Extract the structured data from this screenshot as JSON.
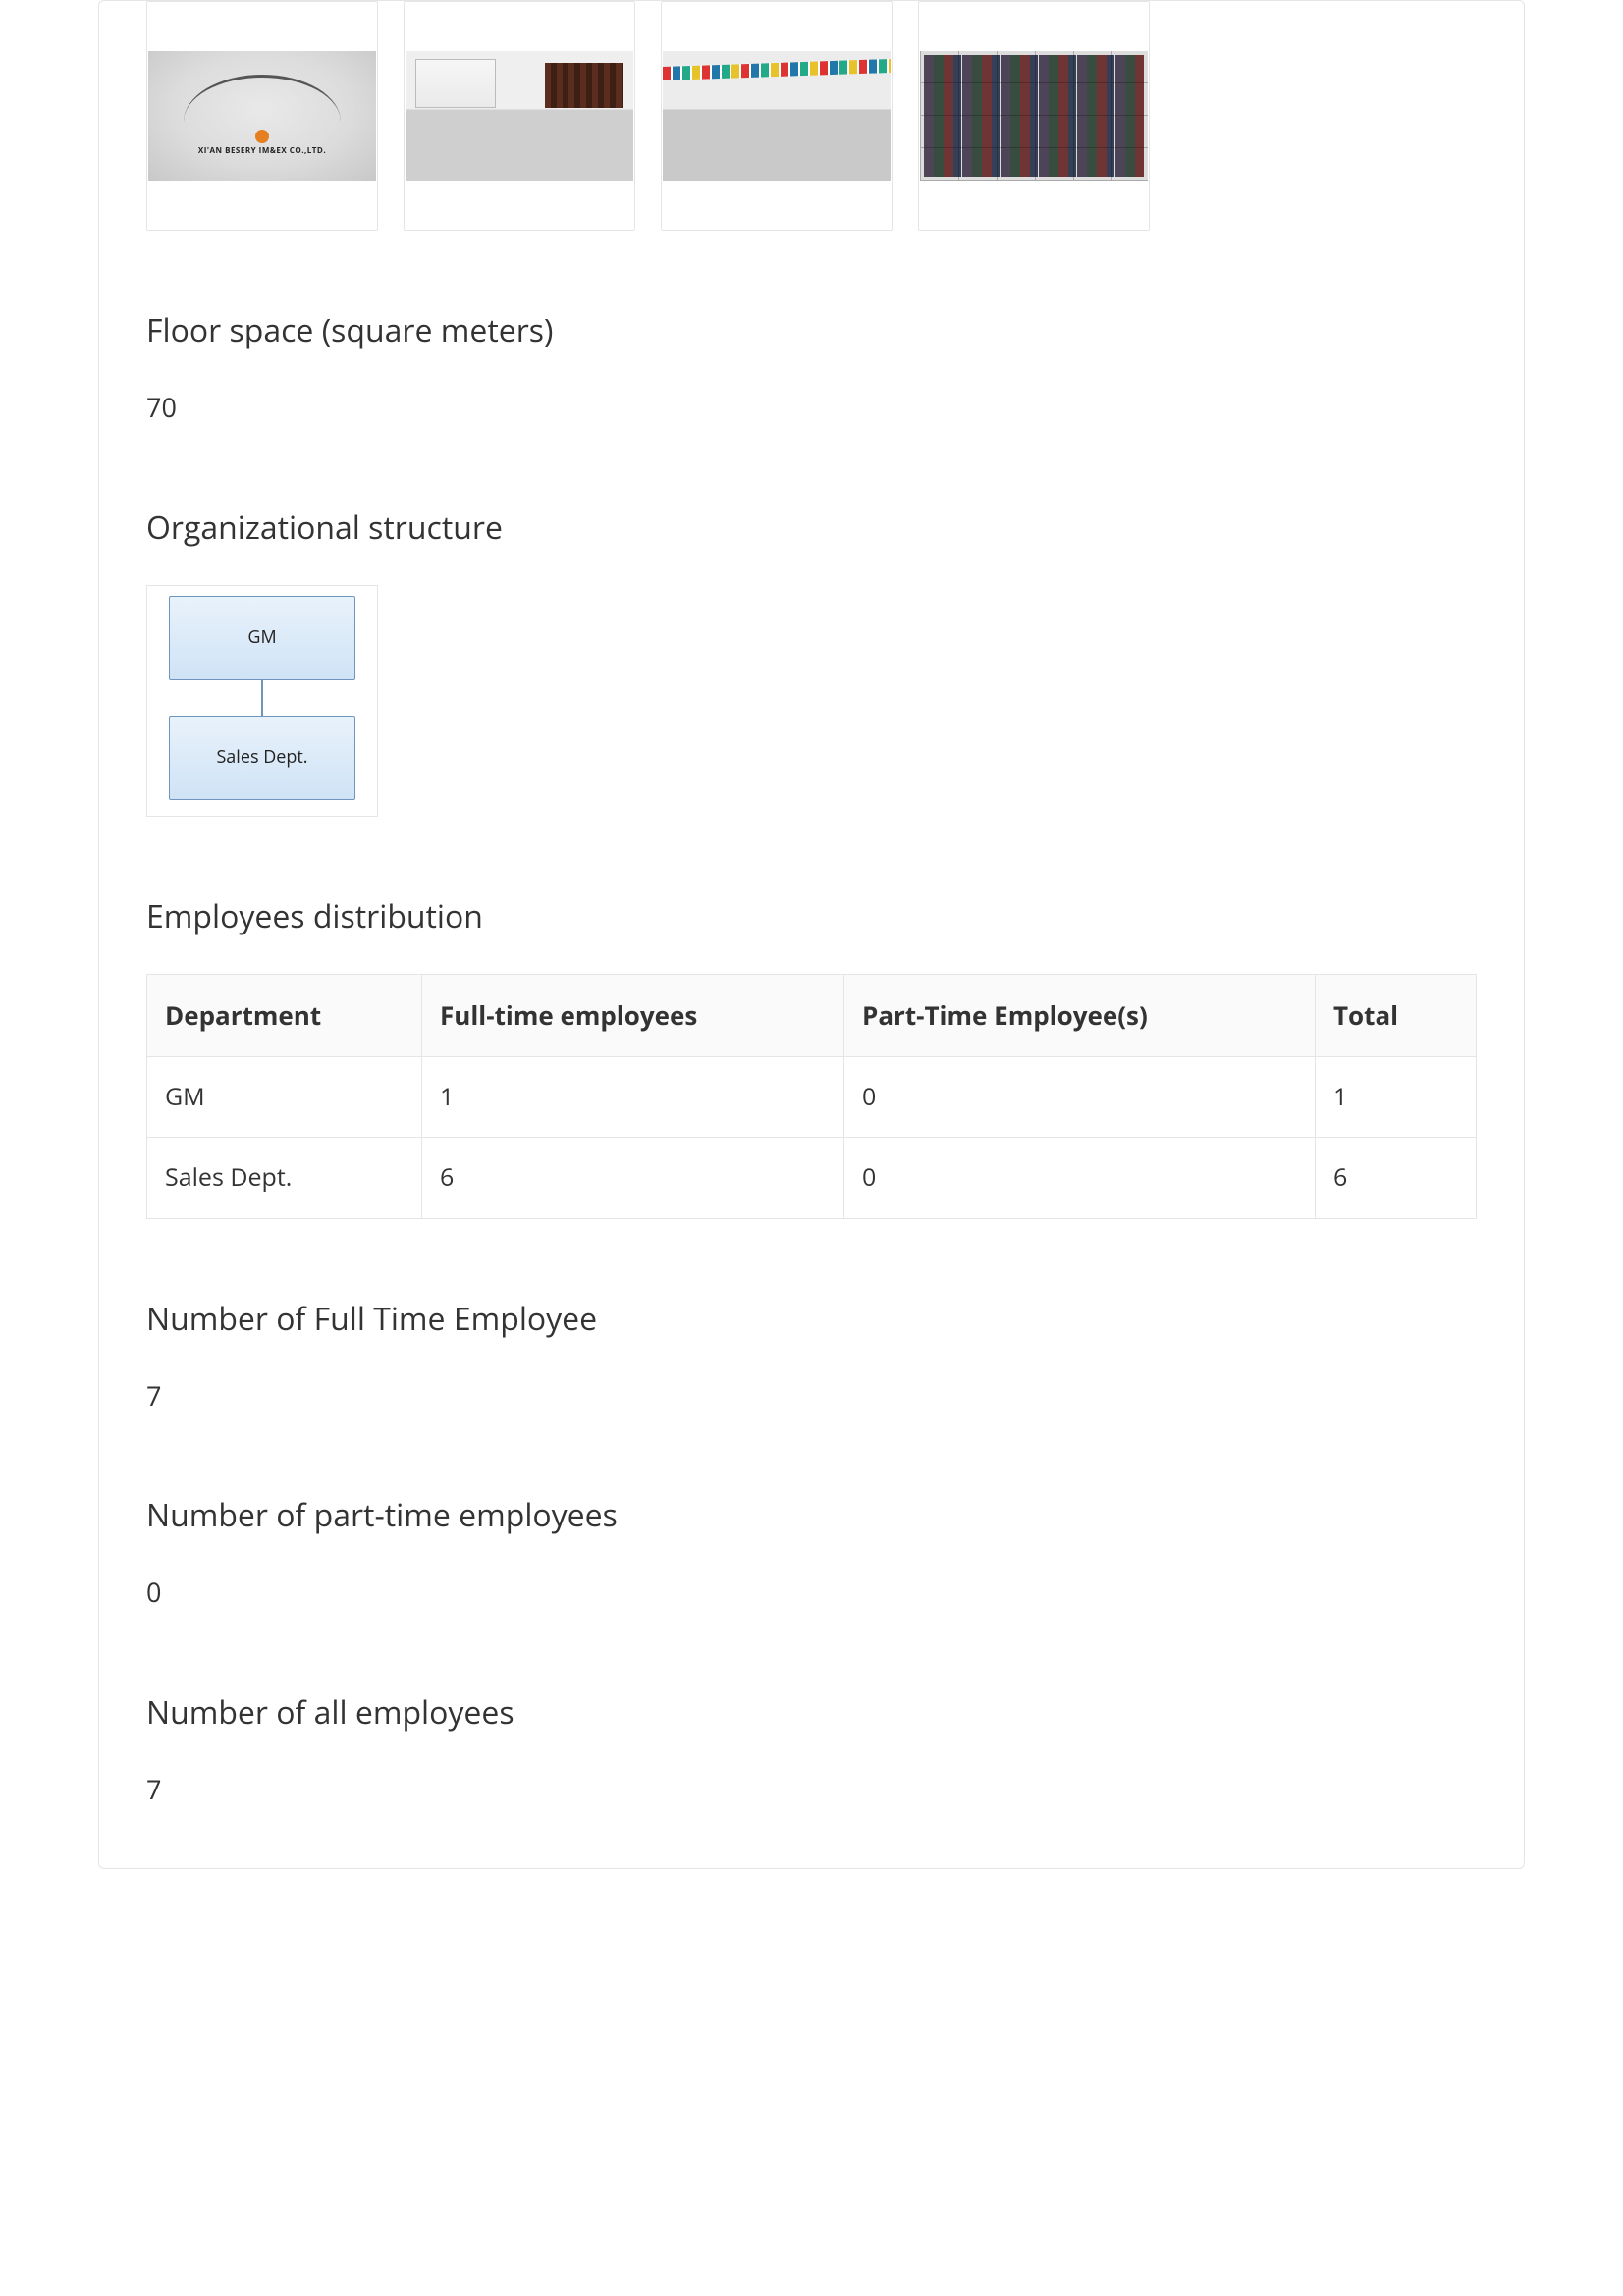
{
  "thumb_caption": "XI'AN BESERY IM&EX CO.,LTD.",
  "floor_space": {
    "label": "Floor space (square meters)",
    "value": "70"
  },
  "org_structure": {
    "heading": "Organizational structure",
    "boxes": [
      "GM",
      "Sales Dept."
    ]
  },
  "employees_distribution": {
    "heading": "Employees distribution",
    "headers": {
      "department": "Department",
      "full_time": "Full-time employees",
      "part_time": "Part-Time Employee(s)",
      "total": "Total"
    },
    "rows": [
      {
        "department": "GM",
        "full_time": "1",
        "part_time": "0",
        "total": "1"
      },
      {
        "department": "Sales Dept.",
        "full_time": "6",
        "part_time": "0",
        "total": "6"
      }
    ]
  },
  "totals": {
    "full_time": {
      "label": "Number of Full Time Employee",
      "value": "7"
    },
    "part_time": {
      "label": "Number of part-time employees",
      "value": "0"
    },
    "all": {
      "label": "Number of all employees",
      "value": "7"
    }
  },
  "chart_data": {
    "type": "table",
    "title": "Employees distribution",
    "columns": [
      "Department",
      "Full-time employees",
      "Part-Time Employee(s)",
      "Total"
    ],
    "rows": [
      [
        "GM",
        1,
        0,
        1
      ],
      [
        "Sales Dept.",
        6,
        0,
        6
      ]
    ],
    "totals": {
      "full_time": 7,
      "part_time": 0,
      "all": 7
    }
  }
}
